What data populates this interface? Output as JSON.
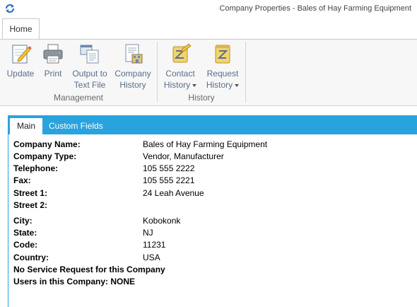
{
  "window": {
    "title": "Company Properties - Bales of Hay Farming Equipment"
  },
  "ribbon": {
    "tabs": [
      "Home"
    ],
    "groups": [
      {
        "label": "Management",
        "buttons": [
          {
            "label": "Update",
            "icon": "update-icon"
          },
          {
            "label": "Print",
            "icon": "printer-icon"
          },
          {
            "label": "Output to",
            "label2": "Text File",
            "icon": "text-file-icon"
          },
          {
            "label": "Company",
            "label2": "History",
            "icon": "company-history-icon"
          }
        ]
      },
      {
        "label": "History",
        "buttons": [
          {
            "label": "Contact",
            "label2": "History",
            "icon": "contact-history-icon",
            "dropdown": true
          },
          {
            "label": "Request",
            "label2": "History",
            "icon": "request-history-icon",
            "dropdown": true
          }
        ]
      }
    ]
  },
  "content": {
    "tabs": [
      "Main",
      "Custom Fields"
    ],
    "fields": [
      {
        "label": "Company Name:",
        "value": "Bales of Hay Farming Equipment"
      },
      {
        "label": "Company Type:",
        "value": "Vendor, Manufacturer"
      },
      {
        "label": "Telephone:",
        "value": "105 555 2222"
      },
      {
        "label": "Fax:",
        "value": "105 555 2221"
      },
      {
        "label": "Street 1:",
        "value": "24 Leah Avenue"
      },
      {
        "label": "Street 2:",
        "value": ""
      },
      {
        "label": "City:",
        "value": "Kobokonk"
      },
      {
        "label": "State:",
        "value": "NJ"
      },
      {
        "label": "Code:",
        "value": "11231"
      },
      {
        "label": "Country:",
        "value": "USA"
      }
    ],
    "notes": [
      "No Service Request for this Company",
      "Users in this Company: NONE"
    ]
  },
  "colors": {
    "accent": "#29a3dd",
    "ribbon_text": "#5a6f87",
    "ribbon_bg": "#f7f7f7"
  }
}
